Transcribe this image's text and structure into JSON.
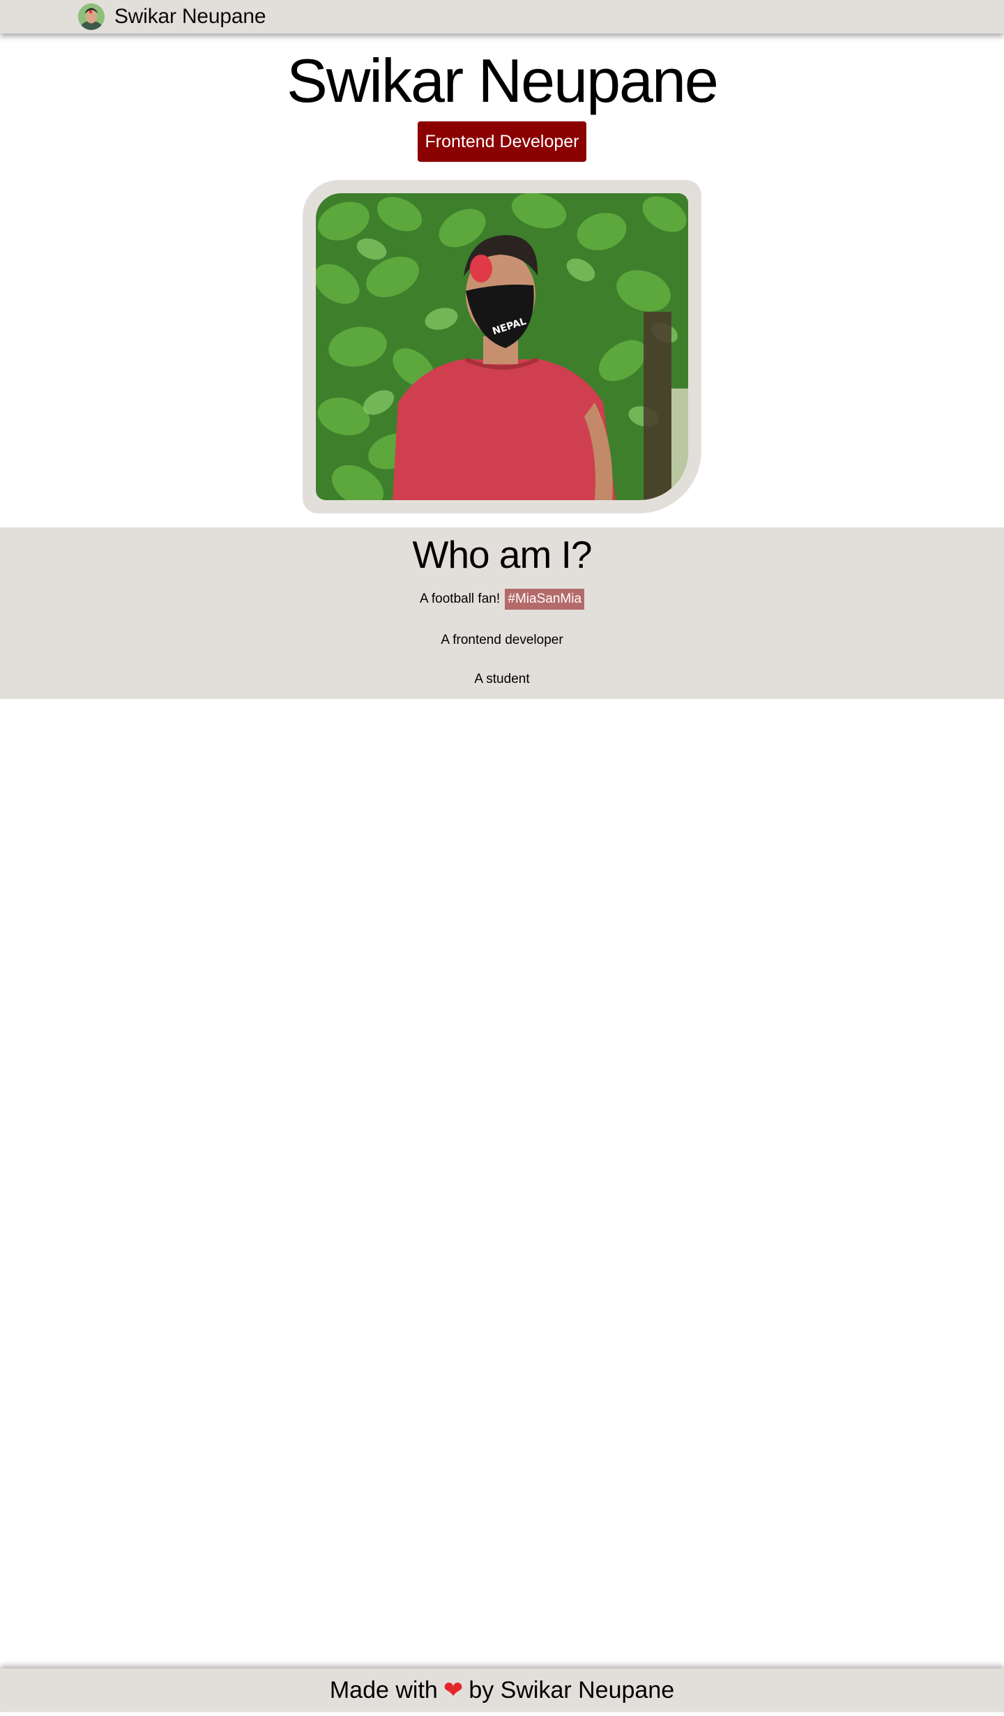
{
  "navbar": {
    "avatar_icon": "profile-avatar",
    "name": "Swikar Neupane"
  },
  "hero": {
    "title": "Swikar Neupane",
    "role": "Frontend Developer",
    "photo_mask_text": "NEPAL",
    "photo_description": "profile-photo"
  },
  "about": {
    "title": "Who am I?",
    "line1_text": "A football fan!",
    "line1_hashtag": "#MiaSanMia",
    "line2": "A frontend developer",
    "line3": "A student"
  },
  "footer": {
    "prefix": "Made with",
    "heart": "❤",
    "suffix": "by Swikar Neupane"
  },
  "colors": {
    "panel_bg": "#e2dfda",
    "badge_bg": "#8b0000",
    "hashtag_bg": "#b56a6a",
    "heart": "#e3262b"
  }
}
